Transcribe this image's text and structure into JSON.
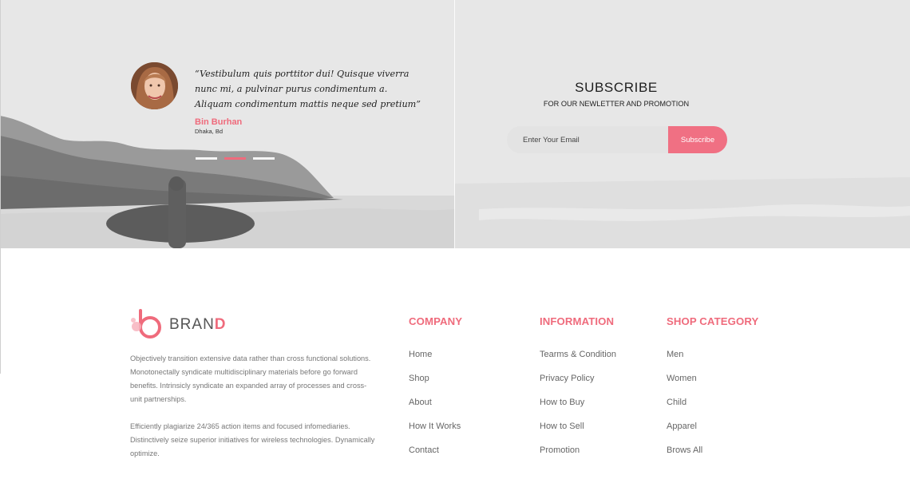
{
  "testimonial": {
    "quote": "“Vestibulum quis porttitor dui! Quisque viverra nunc mi, a pulvinar purus condimentum a. Aliquam condimentum mattis neque sed pretium”",
    "author": "Bin Burhan",
    "location": "Dhaka, Bd",
    "slider_dots": 3,
    "active_dot": 1
  },
  "subscribe": {
    "title": "SUBSCRIBE",
    "subtitle": "FOR OUR NEWLETTER AND PROMOTION",
    "email_placeholder": "Enter Your Email",
    "button_label": "Subscribe"
  },
  "brand": {
    "name_prefix": "BRAN",
    "name_accent": "D",
    "description_1": "Objectively transition extensive data rather than cross functional solutions. Monotonectally syndicate multidisciplinary materials before go forward benefits. Intrinsicly syndicate an expanded array of processes and cross-unit partnerships.",
    "description_2": "Efficiently plagiarize 24/365 action items and focused infomediaries. Distinctively seize superior initiatives for wireless technologies. Dynamically optimize."
  },
  "footer": {
    "company": {
      "heading": "COMPANY",
      "links": [
        "Home",
        "Shop",
        "About",
        "How It Works",
        "Contact"
      ]
    },
    "information": {
      "heading": "INFORMATION",
      "links": [
        "Tearms & Condition",
        "Privacy Policy",
        "How to Buy",
        "How to Sell",
        "Promotion"
      ]
    },
    "shop_category": {
      "heading": "SHOP CATEGORY",
      "links": [
        "Men",
        "Women",
        "Child",
        "Apparel",
        "Brows All"
      ]
    }
  },
  "colors": {
    "accent": "#ef6b7c",
    "button": "#f07083",
    "input_bg": "#e3e3e3"
  }
}
